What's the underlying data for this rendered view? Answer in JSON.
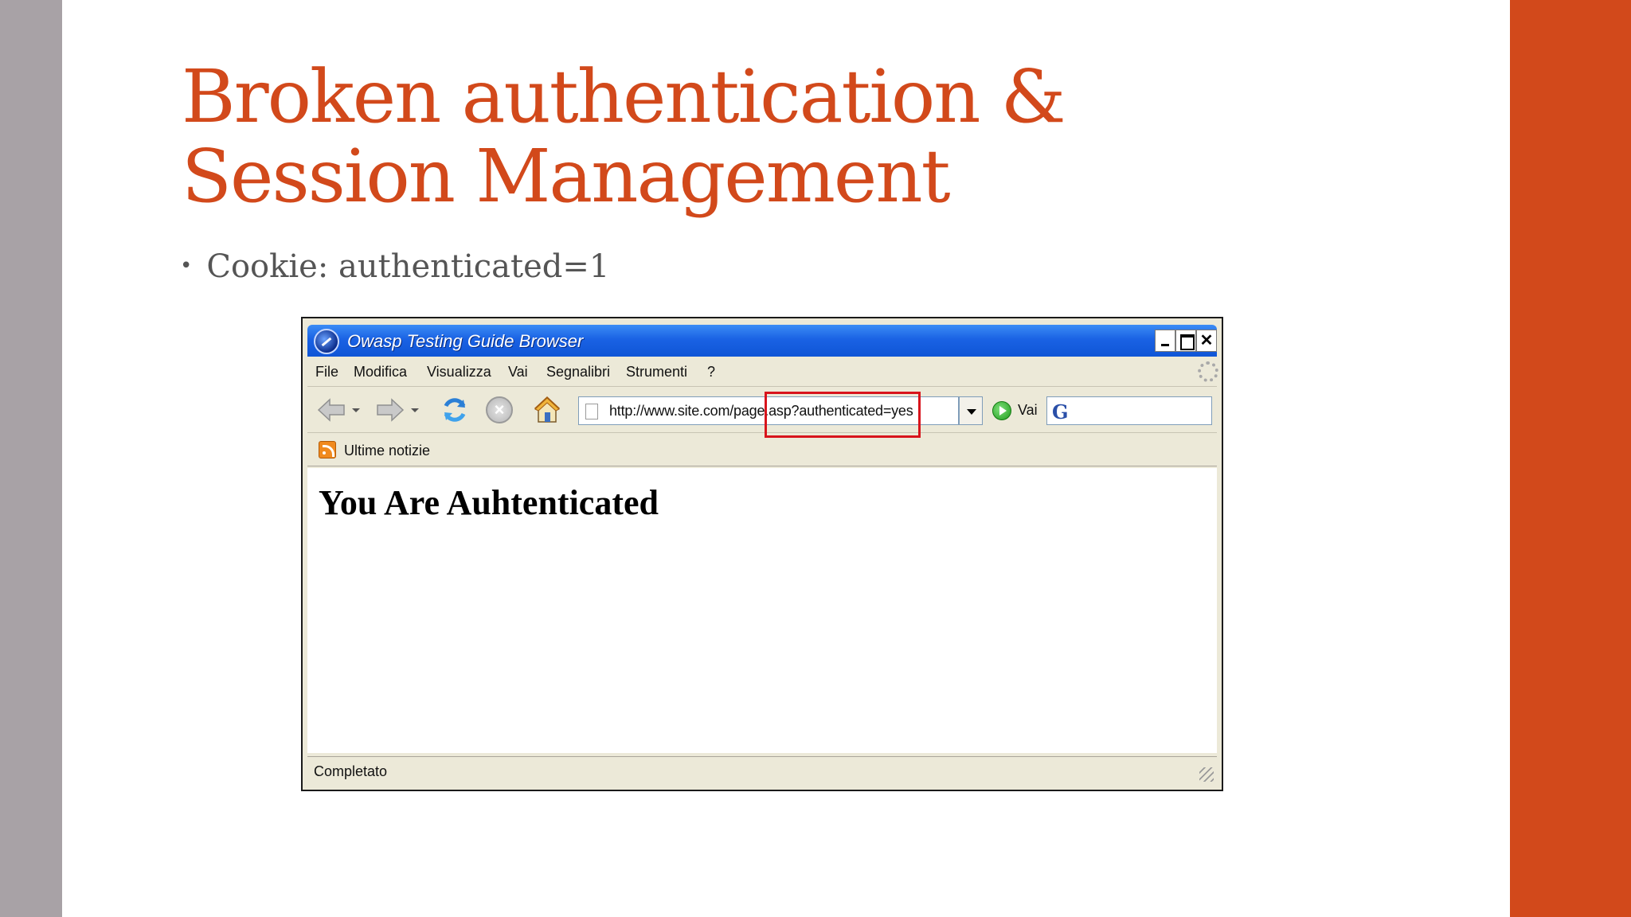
{
  "slide": {
    "title_line1": "Broken authentication &",
    "title_line2": "Session Management",
    "bullet": "Cookie: authenticated=1",
    "accent_color": "#d2491b",
    "side_color": "#a8a2a6"
  },
  "browser": {
    "window_title": "Owasp Testing Guide Browser",
    "menu": [
      "File",
      "Modifica",
      "Visualizza",
      "Vai",
      "Segnalibri",
      "Strumenti",
      "?"
    ],
    "url": "http://www.site.com/page.asp?authenticated=yes",
    "go_label": "Vai",
    "bookmark": "Ultime notizie",
    "page_heading": "You Are Auhtenticated",
    "status": "Completato",
    "icons": {
      "app": "browser-logo-icon",
      "back": "back-arrow-icon",
      "forward": "forward-arrow-icon",
      "reload": "reload-icon",
      "stop": "stop-icon",
      "home": "home-icon",
      "go": "go-icon",
      "rss": "rss-icon",
      "search": "google-icon"
    }
  }
}
